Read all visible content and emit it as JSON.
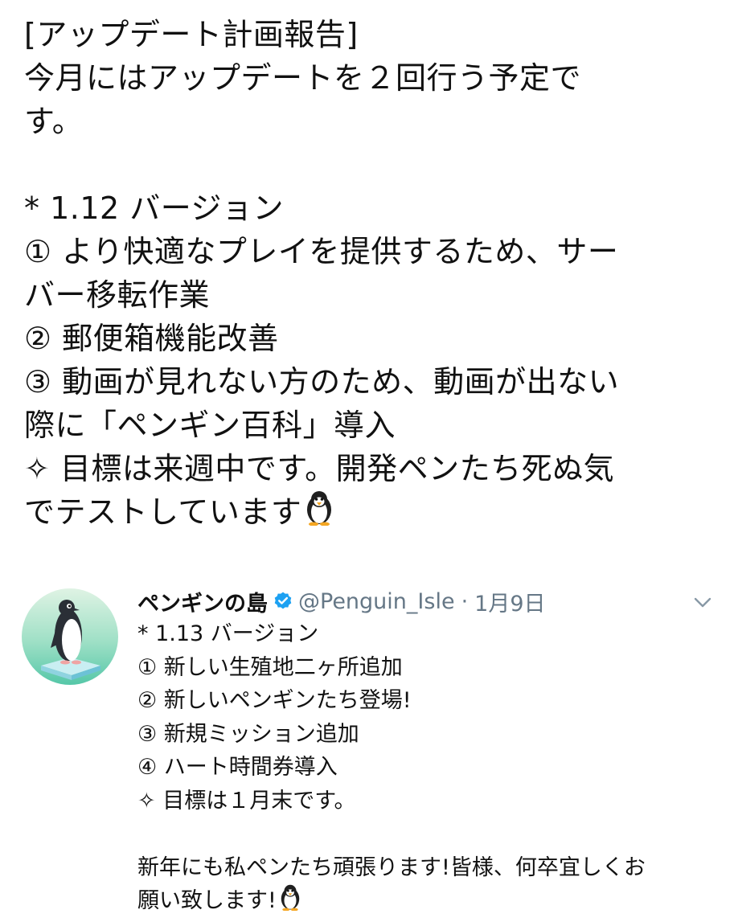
{
  "main_tweet": {
    "lines": [
      "[アップデート計画報告]",
      "今月にはアップデートを２回行う予定で",
      "す。",
      "",
      "* 1.12 バージョン",
      "① より快適なプレイを提供するため、サー",
      "バー移転作業",
      "② 郵便箱機能改善",
      "③ 動画が見れない方のため、動画が出ない",
      "際に「ペンギン百科」導入",
      "✧ 目標は来週中です。開発ペンたち死ぬ気",
      "でテストしています"
    ],
    "trailing_emoji": "penguin-emoji"
  },
  "quoted_tweet": {
    "display_name": "ペンギンの島",
    "verified": true,
    "handle": "@Penguin_Isle",
    "separator": "·",
    "date": "1月9日",
    "lines": [
      "* 1.13 バージョン",
      "① 新しい生殖地二ヶ所追加",
      "② 新しいペンギンたち登場!",
      "③ 新規ミッション追加",
      "④ ハート時間券導入",
      "✧ 目標は１月末です。",
      "",
      "新年にも私ペンたち頑張ります!皆様、何卒宜しくお",
      "願い致します!"
    ],
    "trailing_emoji": "penguin-emoji",
    "icons": {
      "verified": "verified-badge-icon",
      "menu": "chevron-down-icon"
    },
    "colors": {
      "verified": "#1da1f2",
      "secondary_text": "#657786"
    }
  }
}
